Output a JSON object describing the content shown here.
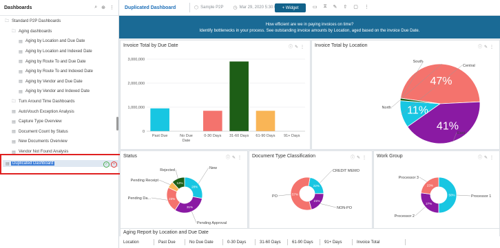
{
  "sidebar": {
    "title": "Dashboards",
    "items": [
      {
        "label": "Standard P2P Dashboards",
        "level": 0,
        "icon": "folder-icon"
      },
      {
        "label": "Aging dashboards",
        "level": 1,
        "icon": "folder-icon"
      },
      {
        "label": "Aging by Location and Due Date",
        "level": 2,
        "icon": "dashboard-icon"
      },
      {
        "label": "Aging by Location and Indexed Date",
        "level": 2,
        "icon": "dashboard-icon"
      },
      {
        "label": "Aging by Route To and Due Date",
        "level": 2,
        "icon": "dashboard-icon"
      },
      {
        "label": "Aging by Route To and Indexed Date",
        "level": 2,
        "icon": "dashboard-icon"
      },
      {
        "label": "Aging by Vendor and Due Date",
        "level": 2,
        "icon": "dashboard-icon"
      },
      {
        "label": "Aging by Vendor and Indexed Date",
        "level": 2,
        "icon": "dashboard-icon"
      },
      {
        "label": "Turn Around Time Dashboards",
        "level": 1,
        "icon": "folder-icon"
      },
      {
        "label": "AutoVouch Exception Analysis",
        "level": 1,
        "icon": "dashboard-icon"
      },
      {
        "label": "Capture Type Overview",
        "level": 1,
        "icon": "dashboard-icon"
      },
      {
        "label": "Document Count by Status",
        "level": 1,
        "icon": "dashboard-icon"
      },
      {
        "label": "New Documents Overview",
        "level": 1,
        "icon": "dashboard-icon"
      },
      {
        "label": "Vendor Not Found Analysis",
        "level": 1,
        "icon": "dashboard-icon"
      }
    ],
    "editing_item": "Duplicated Dashboard"
  },
  "topbar": {
    "title": "Duplicated Dashboard",
    "source": "Sample P2P",
    "date": "Mar 29, 2020 5:30:03 AM",
    "widget_label": "+ Widget"
  },
  "banner": {
    "line1": "How efficient are we in paying invoices on time?",
    "line2": "Identify bottlenecks in your process. See outstanding invoice amounts by Location, aged based on the invoice Due Date."
  },
  "panels": {
    "due_date": "Invoice Total by Due Date",
    "location": "Invoice Total by Location",
    "status": "Status",
    "doctype": "Document Type Classification",
    "workgroup": "Work Group",
    "aging": "Aging Report by Location and Due Date"
  },
  "table_headers": [
    "Location",
    "Past Due",
    "No Due Date",
    "0-30 Days",
    "31-60 Days",
    "61-90 Days",
    "91+ Days",
    "Invoice Total"
  ],
  "colors": {
    "cyan": "#18c6e2",
    "salmon": "#f4736d",
    "green": "#1d5e16",
    "orange": "#f9b556",
    "purple": "#8a1aa3",
    "banner": "#1a6a95",
    "accent": "#12628a"
  },
  "chart_data": [
    {
      "type": "bar",
      "title": "Invoice Total by Due Date",
      "categories": [
        "Past Due",
        "No Due Date",
        "0-30 Days",
        "31-60 Days",
        "61-90 Days",
        "91+ Days"
      ],
      "values": [
        950000,
        0,
        850000,
        2900000,
        850000,
        0
      ],
      "colors": [
        "#18c6e2",
        "#18c6e2",
        "#f4736d",
        "#1d5e16",
        "#f9b556",
        "#8a1aa3"
      ],
      "ylim": [
        0,
        3000000
      ],
      "yticks": [
        "3,000,000",
        "2,000,000",
        "1,000,000",
        "0"
      ]
    },
    {
      "type": "pie",
      "title": "Invoice Total by Location",
      "slices": [
        {
          "label": "North",
          "value": 47,
          "text": "47%",
          "color": "#f4736d"
        },
        {
          "label": "East",
          "value": 41,
          "text": "41%",
          "color": "#8a1aa3"
        },
        {
          "label": "Central",
          "value": 11,
          "text": "11%",
          "color": "#18c6e2"
        },
        {
          "label": "South",
          "value": 1,
          "text": "",
          "color": "#1d5e16"
        }
      ]
    },
    {
      "type": "pie",
      "title": "Status",
      "slices": [
        {
          "label": "New",
          "value": 28,
          "text": "28%",
          "color": "#18c6e2"
        },
        {
          "label": "Pending Approval",
          "value": 31,
          "text": "31%",
          "color": "#8a1aa3"
        },
        {
          "label": "Pending Da...",
          "value": 23,
          "text": "23%",
          "color": "#f4736d"
        },
        {
          "label": "Pending Receipt",
          "value": 6,
          "text": "",
          "color": "#f9b556"
        },
        {
          "label": "Rejected",
          "value": 12,
          "text": "12%",
          "color": "#1d5e16"
        }
      ]
    },
    {
      "type": "pie",
      "title": "Document Type Classification",
      "slices": [
        {
          "label": "CREDIT MEMO",
          "value": 22,
          "text": "22%",
          "color": "#18c6e2"
        },
        {
          "label": "NON-PO",
          "value": 21,
          "text": "21%",
          "color": "#8a1aa3"
        },
        {
          "label": "PO",
          "value": 57,
          "text": "57%",
          "color": "#f4736d"
        }
      ]
    },
    {
      "type": "pie",
      "title": "Work Group",
      "slices": [
        {
          "label": "Processor 1",
          "value": 50,
          "text": "50%",
          "color": "#18c6e2"
        },
        {
          "label": "Processor 2",
          "value": 27,
          "text": "27%",
          "color": "#8a1aa3"
        },
        {
          "label": "Processor 3",
          "value": 23,
          "text": "23%",
          "color": "#f4736d"
        }
      ]
    }
  ]
}
